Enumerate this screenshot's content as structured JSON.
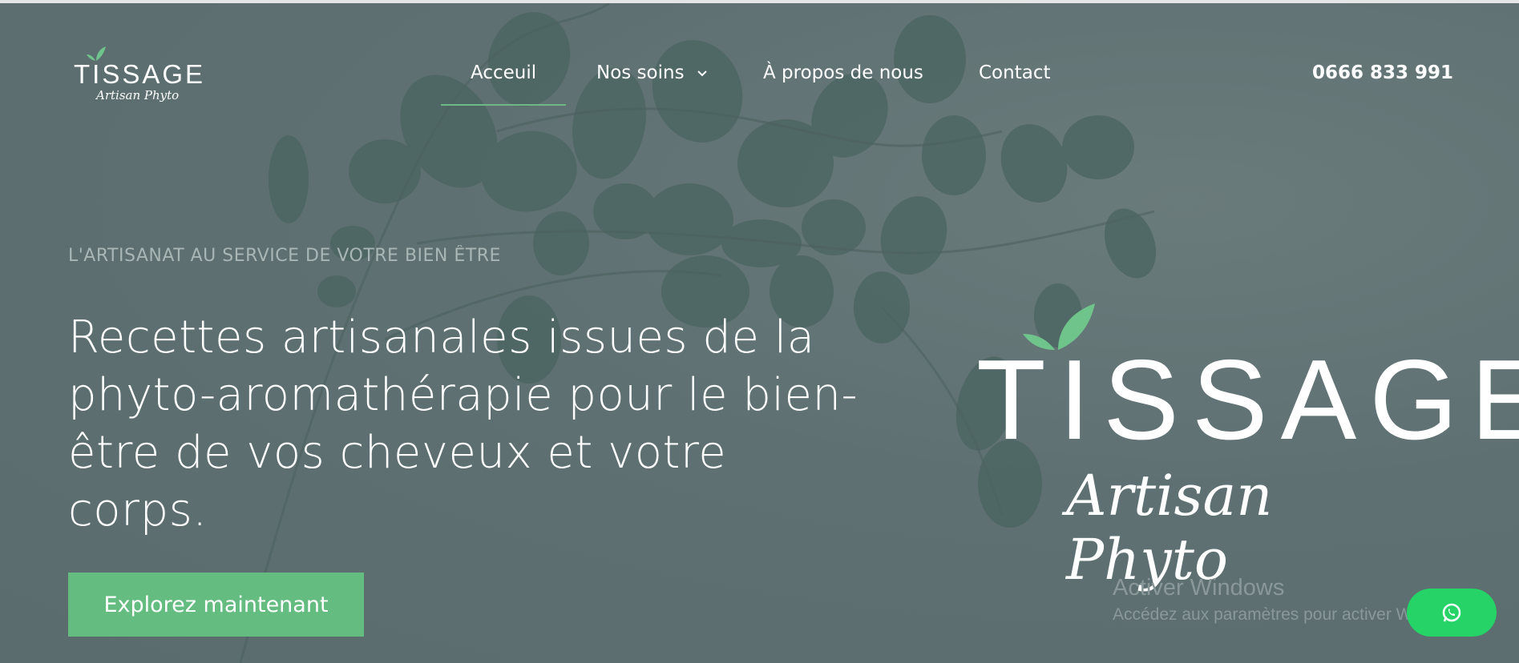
{
  "header": {
    "logo_title": "TISSAGE",
    "logo_subtitle": "Artisan Phyto",
    "nav": {
      "home": "Acceuil",
      "care": "Nos soins",
      "about": "À propos de nous",
      "contact": "Contact"
    },
    "phone": "0666 833 991"
  },
  "hero": {
    "eyebrow": "L'ARTISANAT AU SERVICE DE VOTRE BIEN ÊTRE",
    "headline": "Recettes artisanales issues de la phyto-aromathérapie pour le bien-être de vos cheveux et votre corps.",
    "cta": "Explorez maintenant",
    "brand_title": "TISSAGE",
    "brand_subtitle": "Artisan Phyto"
  },
  "windows_watermark": {
    "title": "Activer Windows",
    "subtitle": "Accédez aux paramètres pour activer Windows."
  },
  "colors": {
    "background": "#5e7072",
    "accent_green": "#65bc80",
    "whatsapp_green": "#25d366",
    "active_underline": "#6fb886"
  },
  "icons": {
    "dropdown": "chevron-down-icon",
    "whatsapp": "whatsapp-icon",
    "logo_leaf": "leaf-icon"
  }
}
